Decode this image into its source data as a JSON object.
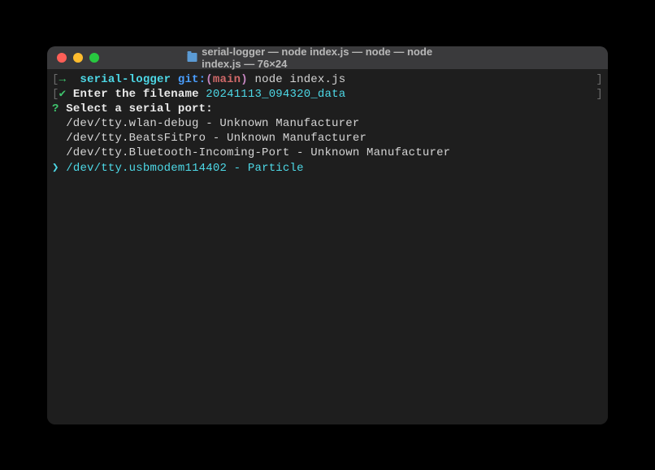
{
  "window": {
    "title": "serial-logger — node index.js — node — node index.js — 76×24"
  },
  "prompt": {
    "arrow": "→",
    "folder": "serial-logger",
    "git_label": "git:",
    "paren_open": "(",
    "branch": "main",
    "paren_close": ")",
    "command": "node index.js"
  },
  "filename_line": {
    "check": "✔",
    "label": "Enter the filename",
    "value": "20241113_094320_data"
  },
  "select": {
    "q": "?",
    "label": "Select a serial port:",
    "options": [
      "/dev/tty.wlan-debug - Unknown Manufacturer",
      "/dev/tty.BeatsFitPro - Unknown Manufacturer",
      "/dev/tty.Bluetooth-Incoming-Port - Unknown Manufacturer"
    ],
    "selected_arrow": "❯",
    "selected": "/dev/tty.usbmodem114402 - Particle"
  }
}
